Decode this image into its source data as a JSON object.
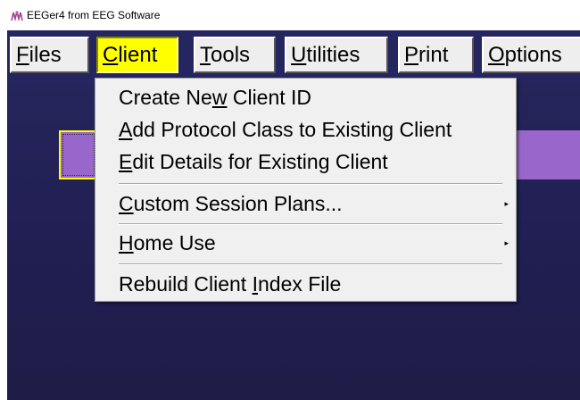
{
  "window": {
    "title": "EEGer4 from EEG Software",
    "icon": "eeger-app-icon"
  },
  "menubar": {
    "items": [
      {
        "accel": "F",
        "rest": "iles"
      },
      {
        "accel": "C",
        "rest": "lient"
      },
      {
        "accel": "T",
        "rest": "ools"
      },
      {
        "accel": "U",
        "rest": "tilities"
      },
      {
        "accel": "P",
        "rest": "rint"
      },
      {
        "accel": "O",
        "rest": "ptions"
      }
    ],
    "active": "Client"
  },
  "client_menu": {
    "items": [
      {
        "pre": "Create Ne",
        "accel": "w",
        "post": " Client ID"
      },
      {
        "pre": "",
        "accel": "A",
        "post": "dd Protocol Class to Existing Client"
      },
      {
        "pre": "",
        "accel": "E",
        "post": "dit Details for Existing Client"
      },
      {
        "pre": "",
        "accel": "C",
        "post": "ustom Session Plans...",
        "submenu": true
      },
      {
        "pre": "",
        "accel": "H",
        "post": "ome Use",
        "submenu": true
      },
      {
        "pre": "Rebuild Client ",
        "accel": "I",
        "post": "ndex File"
      }
    ],
    "submenu_arrow": "▸"
  },
  "colors": {
    "workspace": "#252560",
    "active_menu": "#ffff00",
    "highlight_bar": "#9966cc"
  }
}
